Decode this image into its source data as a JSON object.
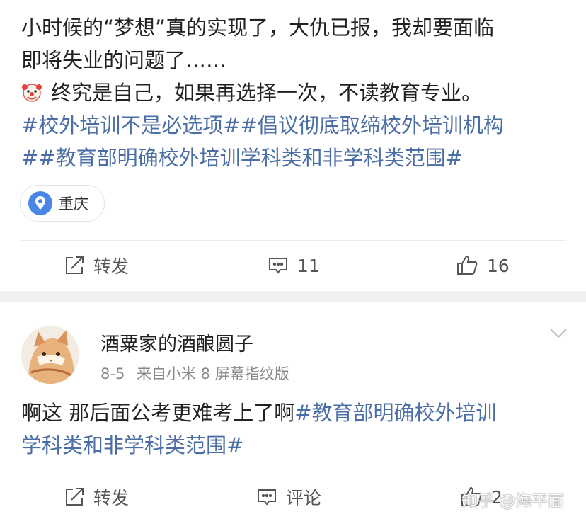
{
  "post": {
    "line1": "小时候的“梦想”真的实现了，大仇已报，我却要面临",
    "line2": "即将失业的问题了……",
    "line3": "终究是自己，如果再选择一次，不读教育专业。",
    "tag1": "#校外培训不是必选项#",
    "tag2": "#倡议彻底取缔校外培训机构",
    "tag3": "#",
    "tag4": "#教育部明确校外培训学科类和非学科类范围#",
    "emoji": "clown-face-icon",
    "location": "重庆"
  },
  "post_actions": {
    "repost_label": "转发",
    "comment_count": "11",
    "like_count": "16"
  },
  "comment": {
    "username": "酒粟家的酒酿圆子",
    "date": "8-5",
    "source": "来自小米 8 屏幕指纹版",
    "text": "啊这 那后面公考更难考上了啊",
    "tag_part1": "#教育部明确校外培训",
    "tag_part2": "学科类和非学科类范围#"
  },
  "comment_actions": {
    "repost_label": "转发",
    "comment_label": "评论",
    "like_count": "2"
  },
  "watermark": "知乎 @海平面",
  "colors": {
    "link": "#4b6ea6",
    "location_pin": "#4a86e8",
    "section_gap": "#f0f0f0"
  }
}
